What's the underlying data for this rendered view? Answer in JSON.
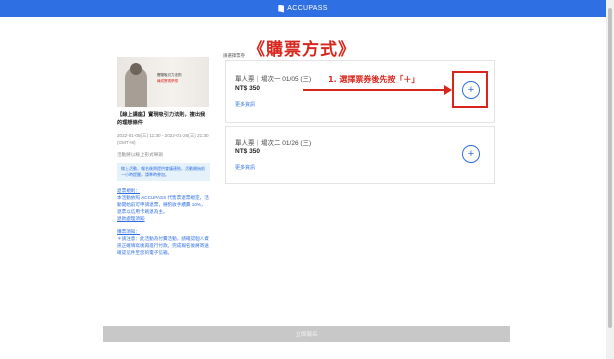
{
  "header": {
    "brand": "ACCUPASS"
  },
  "annotation": {
    "title": "《購票方式》",
    "step": "1. 選擇票券後先按「＋」"
  },
  "event": {
    "image_line1": "實踐吸引力法則",
    "image_line2a": "練成",
    "image_line2b": "實現夢想",
    "title": "【線上講座】實現吸引力法則，複出我的理想條件",
    "datetime": "2022-01-05(三) 11:30 - 2022-01-26(三) 21:30 (GMT+8)",
    "location": "活動將以線上形式舉辦",
    "notice": "線上活動，報名後將提供會議連結，活動開始前一小時提醒。請準時參加。",
    "refund_heading": "退票規則：",
    "refund_text": "本活動依照 ACCUPASS 代售票退票規定，活動開始前可申請退票，將酌收手續費 10%，退票以信用卡刷退為主。",
    "refund_link": "退款處理須知",
    "purchase_heading": "購票須知：",
    "purchase_text": "＊請注意：此活動為付費活動，請確認個人資訊正確填寫後再進行付款。完成報名後將寄送確認信件至您的電子信箱。"
  },
  "tickets": {
    "section_label": "請選擇票券",
    "items": [
      {
        "name": "單人票｜場次一 01/05 (三)",
        "price": "NT$ 350",
        "more": "更多資訊"
      },
      {
        "name": "單人票｜場次二 01/26 (三)",
        "price": "NT$ 350",
        "more": "更多資訊"
      }
    ]
  },
  "footer": {
    "button_label": "立即報名"
  },
  "colors": {
    "brand": "#2f6fe4",
    "annotation": "#d9261c"
  },
  "icons": {
    "plus": "plus-icon",
    "logo": "accupass-logo-icon"
  }
}
